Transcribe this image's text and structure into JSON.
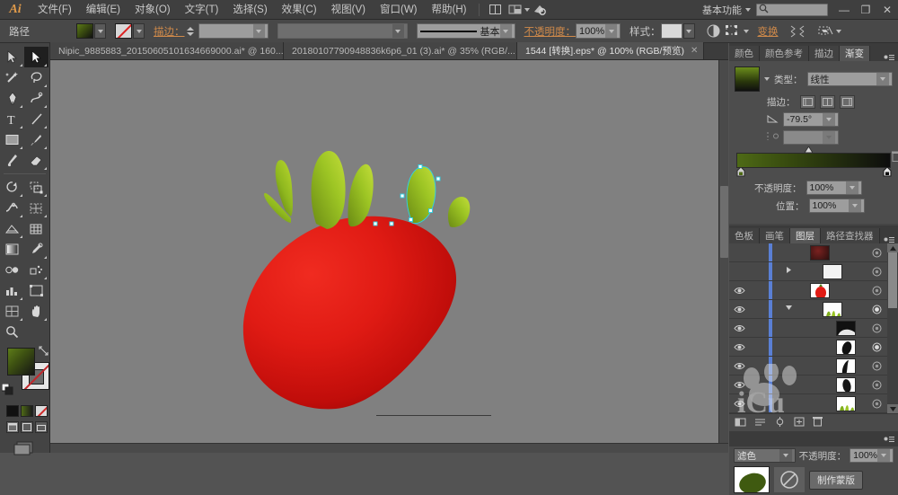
{
  "app": {
    "name": "Adobe Illustrator",
    "logo": "Ai"
  },
  "menubar": {
    "items": [
      {
        "label": "文件(F)",
        "name": "menu-file"
      },
      {
        "label": "编辑(E)",
        "name": "menu-edit"
      },
      {
        "label": "对象(O)",
        "name": "menu-object"
      },
      {
        "label": "文字(T)",
        "name": "menu-type"
      },
      {
        "label": "选择(S)",
        "name": "menu-select"
      },
      {
        "label": "效果(C)",
        "name": "menu-effect"
      },
      {
        "label": "视图(V)",
        "name": "menu-view"
      },
      {
        "label": "窗口(W)",
        "name": "menu-window"
      },
      {
        "label": "帮助(H)",
        "name": "menu-help"
      }
    ],
    "workspace": "基本功能",
    "search_placeholder": "",
    "search_value": "",
    "window_buttons": {
      "minimize": "—",
      "restore": "❐",
      "close": "✕"
    }
  },
  "controlbar": {
    "object_label": "路径",
    "fill_swatch": "green-black-gradient",
    "stroke_swatch": "none",
    "stroke_label": "描边：",
    "stroke_weight": "",
    "stroke_profile": "",
    "brush_label": "基本",
    "opacity_label": "不透明度：",
    "opacity_value": "100%",
    "style_label": "样式：",
    "transform_label": "变换",
    "align_label": ""
  },
  "tabs": [
    {
      "title": "Nipic_9885883_20150605101634669000.ai* @ 160...",
      "active": false,
      "name": "doc-tab-1"
    },
    {
      "title": "20180107790948836k6p6_01 (3).ai* @ 35% (RGB/...",
      "active": false,
      "name": "doc-tab-2"
    },
    {
      "title": "1544 [转换].eps* @ 100% (RGB/预览)",
      "active": true,
      "name": "doc-tab-3"
    }
  ],
  "toolbar": {
    "tools": [
      [
        "选择工具",
        "直接选择工具"
      ],
      [
        "魔棒工具",
        "套索工具"
      ],
      [
        "钢笔工具",
        "曲率工具"
      ],
      [
        "文字工具",
        "直线段工具"
      ],
      [
        "矩形工具",
        "画笔工具"
      ],
      [
        "斑点画笔工具",
        "橡皮擦工具"
      ],
      [
        "旋转工具",
        "缩放工具"
      ],
      [
        "宽度工具",
        "形状生成器工具"
      ],
      [
        "透视网格工具",
        "网格工具"
      ],
      [
        "渐变工具",
        "吸管工具"
      ],
      [
        "混合工具",
        "符号喷枪工具"
      ],
      [
        "柱形图工具",
        "画板工具"
      ],
      [
        "切片工具",
        "抓手工具"
      ],
      [
        "缩放工具",
        ""
      ]
    ],
    "fill_label": "填色",
    "stroke_label": "描边",
    "color_modes": [
      "颜色",
      "渐变",
      "无"
    ],
    "screen_modes": [
      "正常屏幕模式",
      "带有菜单栏的全屏模式",
      "全屏模式"
    ]
  },
  "gradient_panel": {
    "tabs": [
      {
        "label": "颜色",
        "active": false
      },
      {
        "label": "颜色参考",
        "active": false
      },
      {
        "label": "描边",
        "active": false
      },
      {
        "label": "渐变",
        "active": true
      }
    ],
    "type_label": "类型：",
    "type_value": "线性",
    "stroke_label": "描边：",
    "angle_label": "角度",
    "angle_value": "-79.5°",
    "aspect_value": "",
    "opacity_label": "不透明度：",
    "opacity_value": "100%",
    "location_label": "位置：",
    "location_value": "100%",
    "gradient_start": "#4e6a16",
    "gradient_end": "#0d0d0d"
  },
  "layers_panel": {
    "tabs": [
      {
        "label": "色板",
        "active": false
      },
      {
        "label": "画笔",
        "active": false
      },
      {
        "label": "图层",
        "active": true
      },
      {
        "label": "路径查找器",
        "active": false
      }
    ],
    "rows": [
      {
        "visible": false,
        "expandable": false,
        "expanded": false,
        "thumb": "strawberry-dark",
        "selected": false,
        "name": ""
      },
      {
        "visible": false,
        "expandable": true,
        "expanded": false,
        "thumb": "white",
        "selected": false,
        "name": ""
      },
      {
        "visible": true,
        "expandable": false,
        "expanded": false,
        "thumb": "strawberry-red",
        "selected": false,
        "name": ""
      },
      {
        "visible": true,
        "expandable": true,
        "expanded": true,
        "thumb": "leaves-green",
        "selected": true,
        "name": ""
      },
      {
        "visible": true,
        "expandable": false,
        "expanded": false,
        "thumb": "leaf-black",
        "selected": false,
        "name": ""
      },
      {
        "visible": true,
        "expandable": false,
        "expanded": false,
        "thumb": "leaf-black2",
        "selected": true,
        "name": ""
      },
      {
        "visible": true,
        "expandable": false,
        "expanded": false,
        "thumb": "leaf-white",
        "selected": false,
        "name": ""
      },
      {
        "visible": true,
        "expandable": false,
        "expanded": false,
        "thumb": "leaf-black3",
        "selected": false,
        "name": ""
      },
      {
        "visible": true,
        "expandable": false,
        "expanded": false,
        "thumb": "leaves-green2",
        "selected": false,
        "name": ""
      }
    ]
  },
  "transparency_panel": {
    "blend_mode": "滤色",
    "opacity_label": "不透明度：",
    "opacity_value": "100%",
    "make_mask_label": "制作蒙版"
  },
  "canvas": {
    "zoom": "100%",
    "artwork": "草莓 (strawberry illustration)",
    "background": "#808080"
  }
}
